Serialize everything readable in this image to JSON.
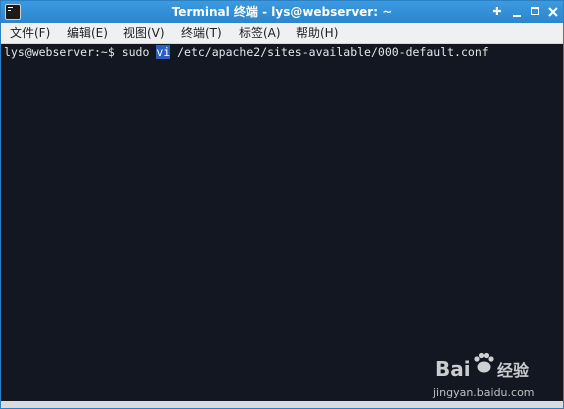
{
  "window": {
    "title": "Terminal 终端 - lys@webserver: ~",
    "pin_glyph": "✚"
  },
  "menu": [
    {
      "label": "文件(F)"
    },
    {
      "label": "编辑(E)"
    },
    {
      "label": "视图(V)"
    },
    {
      "label": "终端(T)"
    },
    {
      "label": "标签(A)"
    },
    {
      "label": "帮助(H)"
    }
  ],
  "terminal": {
    "prompt": "lys@webserver:~$ ",
    "command_pre": "sudo ",
    "command_selected": "vi",
    "command_post": " /etc/apache2/sites-available/000-default.conf"
  },
  "watermark": {
    "brand": "Bai",
    "brand_cn": "经验",
    "url": "jingyan.baidu.com"
  },
  "colors": {
    "titlebar": "#2b86cf",
    "terminal_bg": "#131722",
    "terminal_fg": "#e6e6e6",
    "selection": "#2b5fc1"
  }
}
